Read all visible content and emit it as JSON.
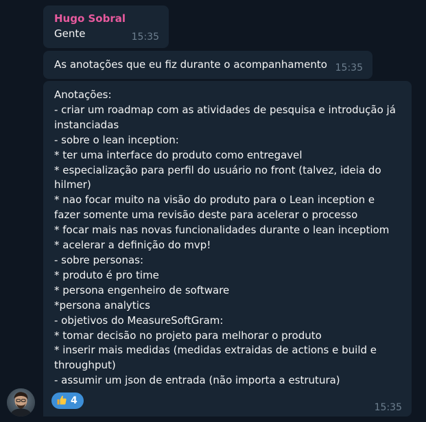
{
  "messages": [
    {
      "sender": "Hugo Sobral",
      "text": "Gente",
      "time": "15:35"
    },
    {
      "text": "As anotações que eu fiz durante o acompanhamento",
      "time": "15:35"
    },
    {
      "lines": [
        "Anotações:",
        "- criar um roadmap com as atividades de pesquisa e introdução já",
        "instanciadas",
        "- sobre o lean inception:",
        "* ter uma interface do produto como entregavel",
        "* especialização para perfil do usuário no front (talvez, ideia do",
        "hilmer)",
        "* nao focar muito na visão do produto para o Lean inception e",
        "fazer somente uma revisão deste para acelerar o processo",
        "* focar mais nas novas funcionalidades durante o lean inceptiom",
        "* acelerar a definição do mvp!",
        "- sobre personas:",
        "* produto é pro time",
        "* persona engenheiro de software",
        "*persona analytics",
        "- objetivos do MeasureSoftGram:",
        "* tomar decisão no projeto para melhorar o produto",
        "* inserir mais medidas (medidas extraidas de actions e build e",
        "throughput)",
        "- assumir um json de entrada (não importa a estrutura)"
      ],
      "reaction": {
        "icon": "thumbs-up-icon",
        "count": "4"
      },
      "time": "15:35"
    }
  ],
  "colors": {
    "background": "#0e1621",
    "bubble": "#182533",
    "sender_name": "#e85a9e",
    "time": "#6d7f8f",
    "reaction_bg": "#3d8fd8"
  }
}
